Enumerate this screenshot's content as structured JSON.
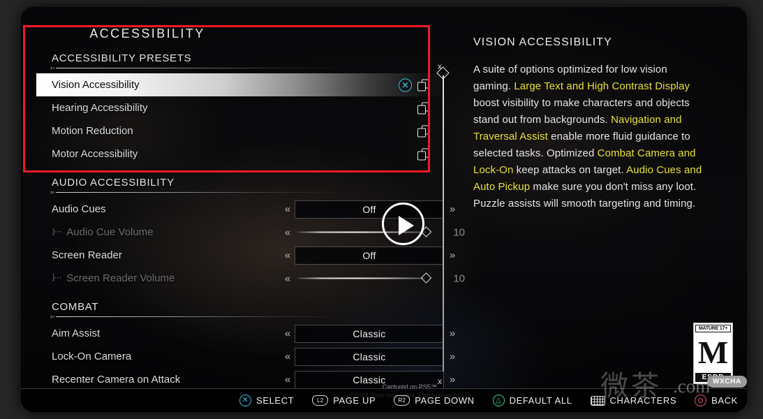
{
  "menu": {
    "page_title": "ACCESSIBILITY",
    "sections": [
      {
        "id": "presets",
        "title": "ACCESSIBILITY PRESETS",
        "rows": [
          {
            "label": "Vision Accessibility",
            "type": "preset",
            "selected": true,
            "x_icon": "cross-button-icon",
            "copies_icon": "copies-icon"
          },
          {
            "label": "Hearing Accessibility",
            "type": "preset",
            "selected": false,
            "copies_icon": "copies-icon"
          },
          {
            "label": "Motion Reduction",
            "type": "preset",
            "selected": false,
            "copies_icon": "copies-icon"
          },
          {
            "label": "Motor Accessibility",
            "type": "preset",
            "selected": false,
            "copies_icon": "copies-icon"
          }
        ]
      },
      {
        "id": "audio",
        "title": "AUDIO ACCESSIBILITY",
        "rows": [
          {
            "label": "Audio Cues",
            "type": "option",
            "value": "Off",
            "arrow_left": "«",
            "arrow_right": "»",
            "dim": false
          },
          {
            "label": "Audio Cue Volume",
            "type": "slider",
            "value": "10",
            "arrow_left": "«",
            "dim": true,
            "sub": true
          },
          {
            "label": "Screen Reader",
            "type": "option",
            "value": "Off",
            "arrow_left": "«",
            "arrow_right": "»",
            "dim": false
          },
          {
            "label": "Screen Reader Volume",
            "type": "slider",
            "value": "10",
            "arrow_left": "«",
            "dim": true,
            "sub": true
          }
        ]
      },
      {
        "id": "combat",
        "title": "COMBAT",
        "rows": [
          {
            "label": "Aim Assist",
            "type": "option",
            "value": "Classic",
            "arrow_left": "«",
            "arrow_right": "»",
            "dim": false
          },
          {
            "label": "Lock-On Camera",
            "type": "option",
            "value": "Classic",
            "arrow_left": "«",
            "arrow_right": "»",
            "dim": false
          },
          {
            "label": "Recenter Camera on Attack",
            "type": "option",
            "value": "Classic",
            "arrow_left": "«",
            "arrow_right": "»",
            "dim": false
          }
        ]
      }
    ]
  },
  "description": {
    "heading": "VISION ACCESSIBILITY",
    "segments": [
      {
        "text": "A suite of options optimized for low vision gaming. ",
        "highlight": false
      },
      {
        "text": "Large Text and High Contrast Display",
        "highlight": true
      },
      {
        "text": " boost visibility to make characters and objects stand out from backgrounds. ",
        "highlight": false
      },
      {
        "text": "Navigation and Traversal Assist",
        "highlight": true
      },
      {
        "text": " enable more fluid guidance to selected tasks. Optimized ",
        "highlight": false
      },
      {
        "text": "Combat Camera and Lock-On",
        "highlight": true
      },
      {
        "text": " keep attacks on target. ",
        "highlight": false
      },
      {
        "text": "Audio Cues and Auto Pickup",
        "highlight": true
      },
      {
        "text": " make sure you don't miss any loot. Puzzle assists will smooth targeting and timing.",
        "highlight": false
      }
    ],
    "highlight_color": "#e6e03c"
  },
  "footer": {
    "hints": [
      {
        "glyph": "✕",
        "glyph_type": "cross-button",
        "label": "SELECT"
      },
      {
        "glyph": "L2",
        "glyph_type": "l2-shoulder",
        "label": "PAGE UP"
      },
      {
        "glyph": "R2",
        "glyph_type": "r2-shoulder",
        "label": "PAGE DOWN"
      },
      {
        "glyph": "△",
        "glyph_type": "triangle-button",
        "label": "DEFAULT ALL"
      },
      {
        "glyph": "",
        "glyph_type": "touchpad",
        "label": "CHARACTERS"
      },
      {
        "glyph": "○",
        "glyph_type": "circle-button",
        "label": "BACK"
      }
    ]
  },
  "captured": {
    "line1": "Captured on PS5™.",
    "line2": "©2022 Sony Interactive Entertainment LLC."
  },
  "esrb": {
    "top": "MATURE 17+",
    "letter": "M",
    "bottom": "ESRB"
  },
  "overlay": {
    "play_button_label": "play-video",
    "annotation_color": "#ec1b24"
  },
  "watermark": {
    "cjk": "微茶",
    "domain": ".com",
    "badge": "WXCHA"
  }
}
